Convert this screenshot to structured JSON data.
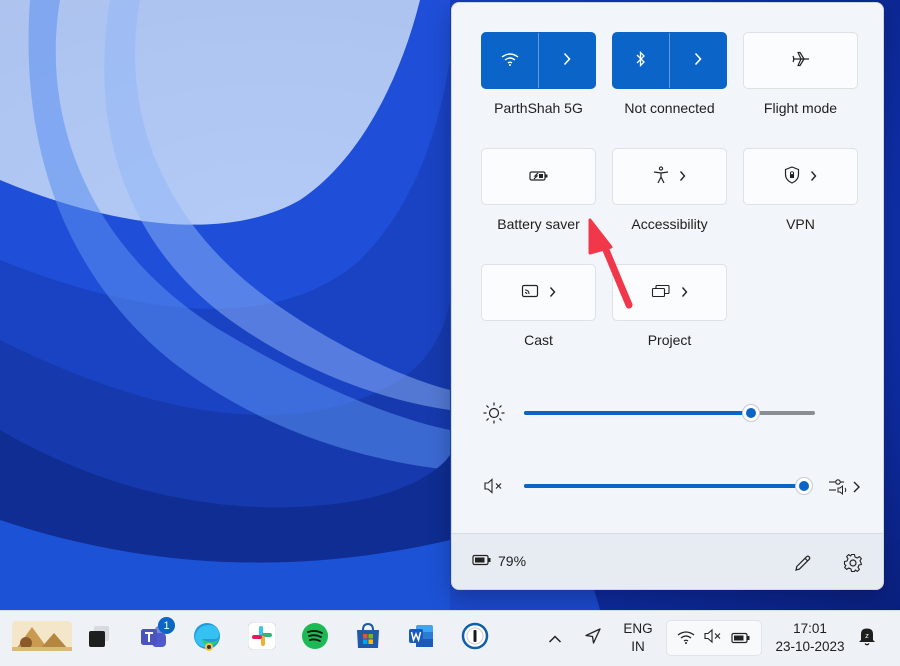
{
  "quick_settings": {
    "tiles": [
      {
        "label": "ParthShah 5G",
        "icon": "wifi-icon",
        "active": true,
        "split": true
      },
      {
        "label": "Not connected",
        "icon": "bluetooth-icon",
        "active": true,
        "split": true
      },
      {
        "label": "Flight mode",
        "icon": "airplane-icon",
        "active": false,
        "split": false
      },
      {
        "label": "Battery saver",
        "icon": "battery-saver-icon",
        "active": false,
        "split": false
      },
      {
        "label": "Accessibility",
        "icon": "accessibility-icon",
        "active": false,
        "split": false
      },
      {
        "label": "VPN",
        "icon": "vpn-shield-icon",
        "active": false,
        "split": false
      },
      {
        "label": "Cast",
        "icon": "cast-icon",
        "active": false,
        "split": false
      },
      {
        "label": "Project",
        "icon": "project-icon",
        "active": false,
        "split": false
      }
    ],
    "brightness": {
      "level_percent": 78
    },
    "volume": {
      "level_percent": 100,
      "muted": true
    },
    "battery_text": "79%"
  },
  "taskbar": {
    "language_line1": "ENG",
    "language_line2": "IN",
    "time": "17:01",
    "date": "23-10-2023",
    "teams_badge": "1"
  },
  "colors": {
    "accent": "#0b64c8",
    "annotation_arrow": "#f0384a"
  }
}
